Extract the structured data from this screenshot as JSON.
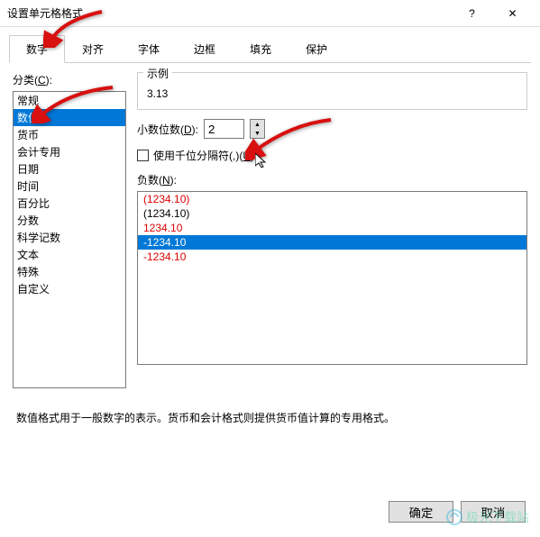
{
  "window": {
    "title": "设置单元格格式",
    "question": "?",
    "close": "✕"
  },
  "tabs": [
    "数字",
    "对齐",
    "字体",
    "边框",
    "填充",
    "保护"
  ],
  "active_tab_index": 0,
  "category": {
    "label": "分类(",
    "accel": "C",
    "label_end": "):",
    "items": [
      "常规",
      "数值",
      "货币",
      "会计专用",
      "日期",
      "时间",
      "百分比",
      "分数",
      "科学记数",
      "文本",
      "特殊",
      "自定义"
    ],
    "selected_index": 1
  },
  "example": {
    "label": "示例",
    "value": "3.13"
  },
  "decimal": {
    "label": "小数位数(",
    "accel": "D",
    "label_end": "):",
    "value": "2"
  },
  "separator": {
    "label": "使用千位分隔符(,)(",
    "accel": "U",
    "label_end": ")",
    "checked": false
  },
  "negative": {
    "label": "负数(",
    "accel": "N",
    "label_end": "):",
    "items": [
      {
        "text": "(1234.10)",
        "red": true
      },
      {
        "text": "(1234.10)",
        "red": false
      },
      {
        "text": "1234.10",
        "red": true
      },
      {
        "text": "-1234.10",
        "red": false
      },
      {
        "text": "-1234.10",
        "red": true
      }
    ],
    "selected_index": 3
  },
  "description": "数值格式用于一般数字的表示。货币和会计格式则提供货币值计算的专用格式。",
  "buttons": {
    "ok": "确定",
    "cancel": "取消"
  },
  "watermark": "极光下载站"
}
